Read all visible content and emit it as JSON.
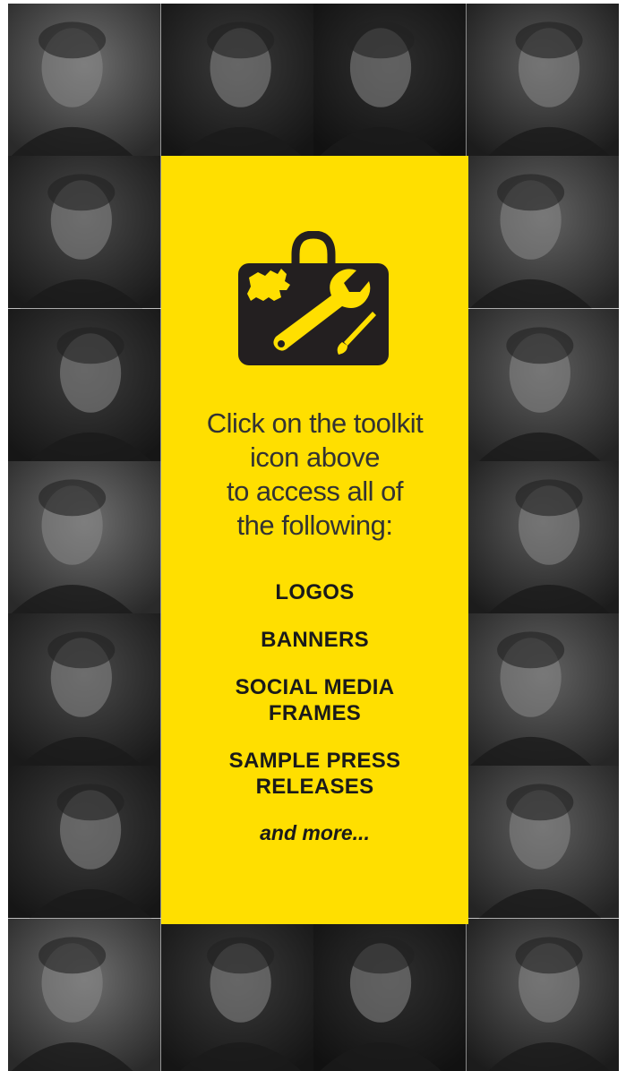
{
  "intro": {
    "line1": "Click on the toolkit",
    "line2": "icon above",
    "line3": "to access all of",
    "line4": "the following:"
  },
  "items": [
    "LOGOS",
    "BANNERS",
    "SOCIAL MEDIA FRAMES",
    "SAMPLE PRESS RELEASES"
  ],
  "more": "and more...",
  "colors": {
    "panel": "#ffdf00",
    "toolkit_case": "#231f20",
    "text": "#222222"
  },
  "icons": {
    "toolkit": "toolkit-icon",
    "canada_map": "canada-map-icon",
    "wrench": "wrench-icon",
    "paintbrush": "paintbrush-icon"
  }
}
